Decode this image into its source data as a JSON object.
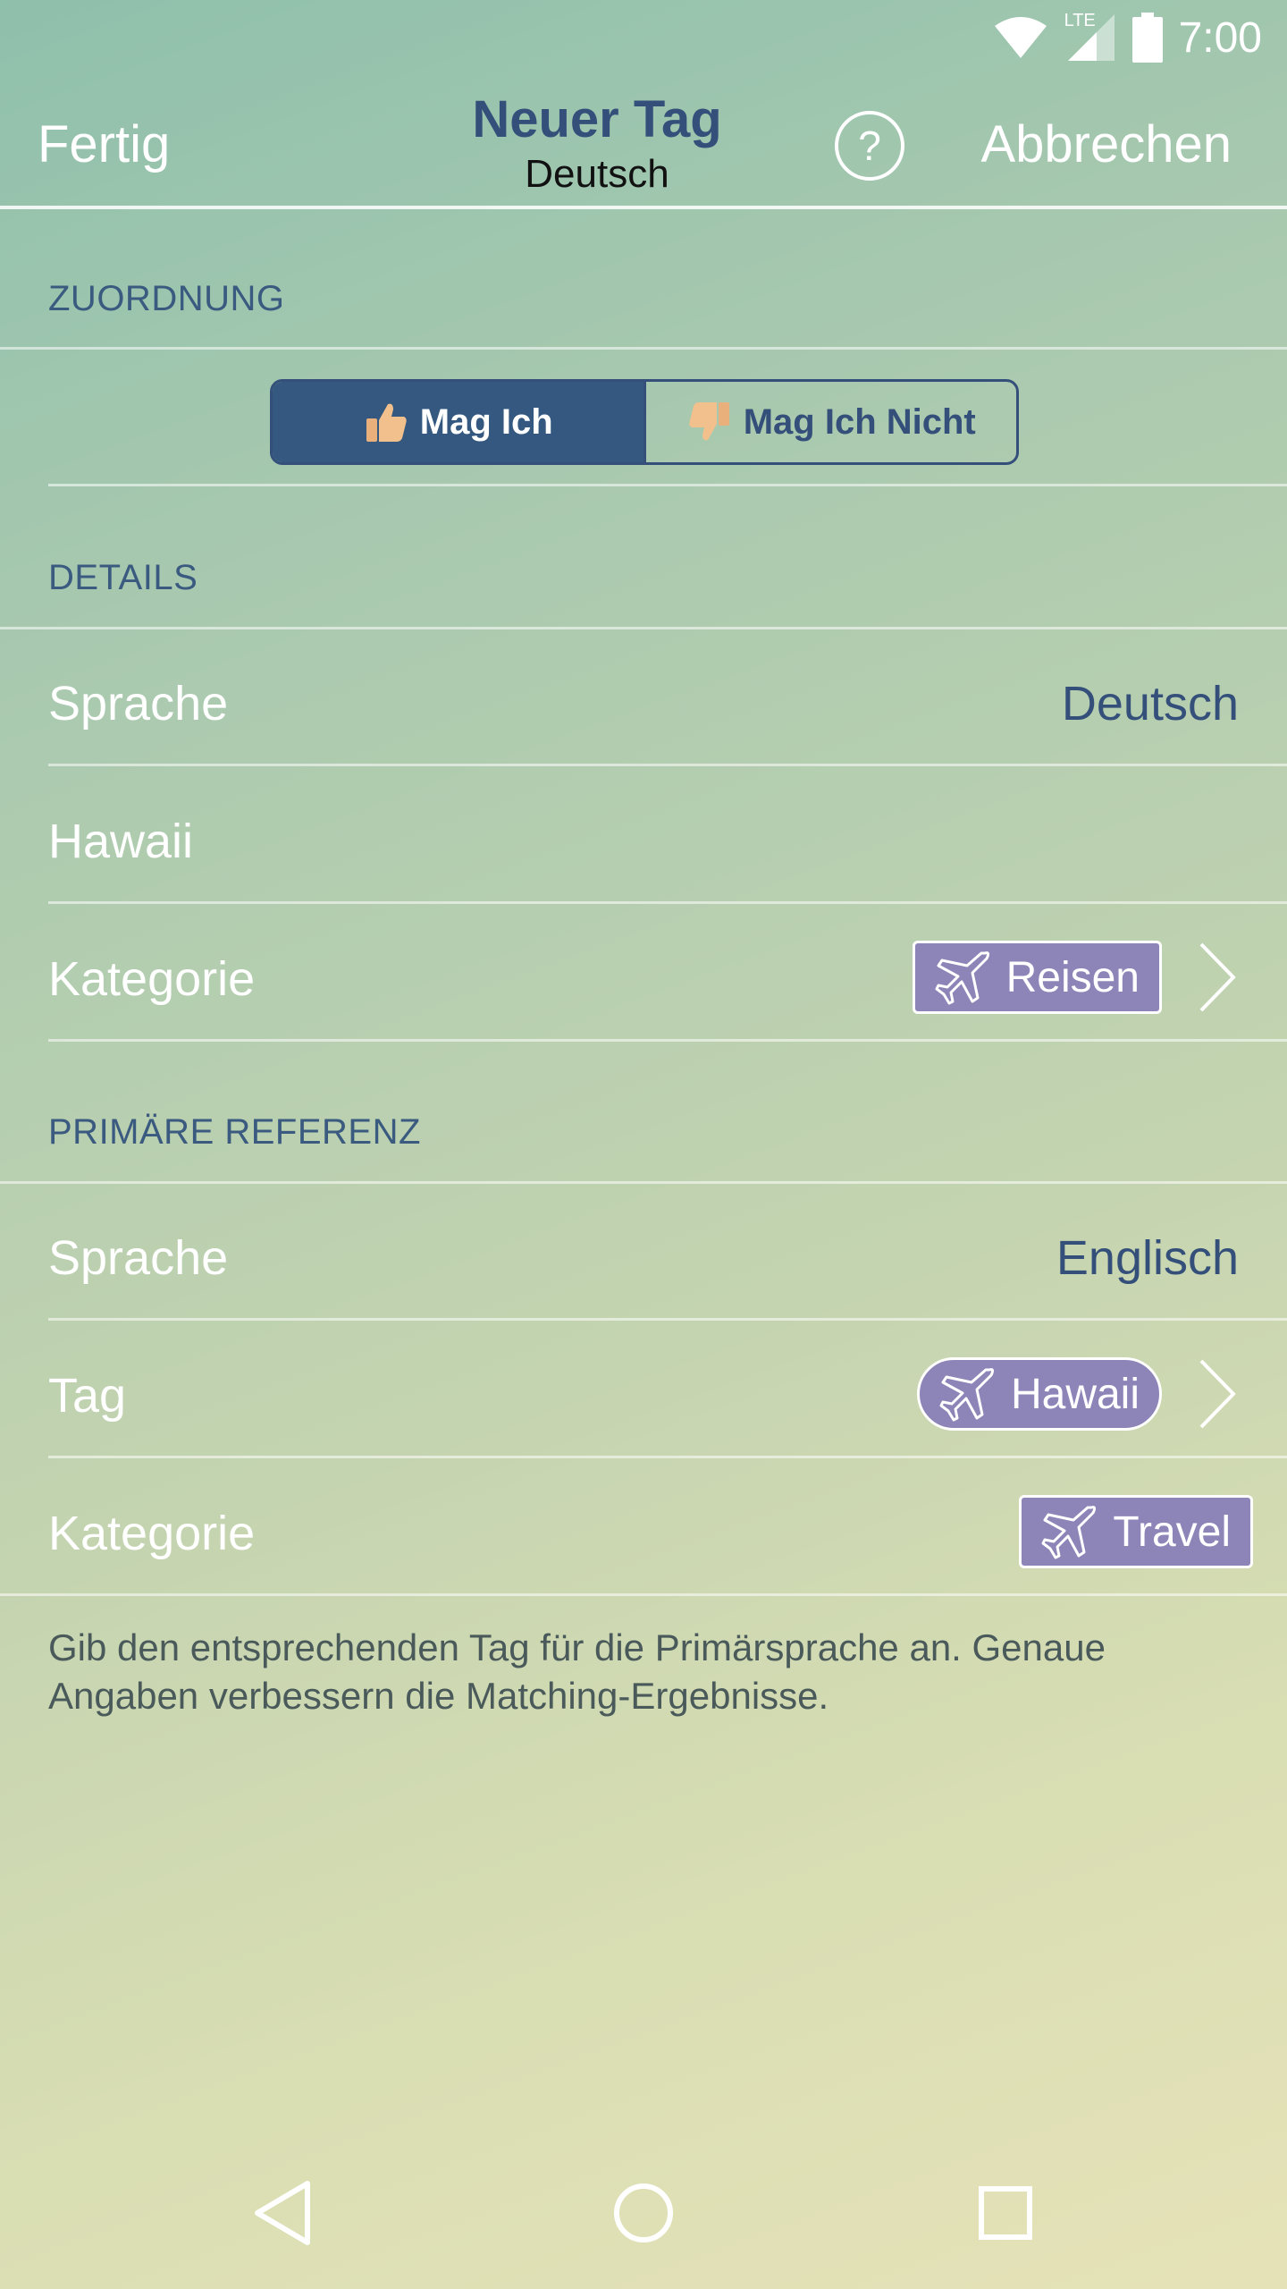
{
  "status_bar": {
    "time": "7:00",
    "network": "LTE",
    "icons": [
      "wifi-icon",
      "cell-signal-icon",
      "battery-icon"
    ]
  },
  "header": {
    "left_label": "Fertig",
    "title": "Neuer Tag",
    "subtitle": "Deutsch",
    "help_label": "?",
    "right_label": "Abbrechen"
  },
  "zuordnung": {
    "section_title": "ZUORDNUNG",
    "options": [
      {
        "label": "Mag Ich",
        "icon": "thumbs-up-icon",
        "selected": true
      },
      {
        "label": "Mag Ich Nicht",
        "icon": "thumbs-down-icon",
        "selected": false
      }
    ]
  },
  "details": {
    "section_title": "DETAILS",
    "language_label": "Sprache",
    "language_value": "Deutsch",
    "tag_value": "Hawaii",
    "category_label": "Kategorie",
    "category_chip": {
      "label": "Reisen",
      "icon": "airplane-icon"
    }
  },
  "primary_reference": {
    "section_title": "PRIMÄRE REFERENZ",
    "language_label": "Sprache",
    "language_value": "Englisch",
    "tag_label": "Tag",
    "tag_chip": {
      "label": "Hawaii",
      "icon": "airplane-icon"
    },
    "category_label": "Kategorie",
    "category_chip": {
      "label": "Travel",
      "icon": "airplane-icon"
    }
  },
  "footnote": "Gib den entsprechenden Tag für die Primärsprache an. Genaue Angaben verbessern die Matching-Ergebnisse.",
  "colors": {
    "accent": "#34507a",
    "chip": "#8d85b8",
    "segment_active": "#34587f"
  },
  "nav_bar": {
    "icons": [
      "back-icon",
      "home-icon",
      "recents-icon"
    ]
  }
}
